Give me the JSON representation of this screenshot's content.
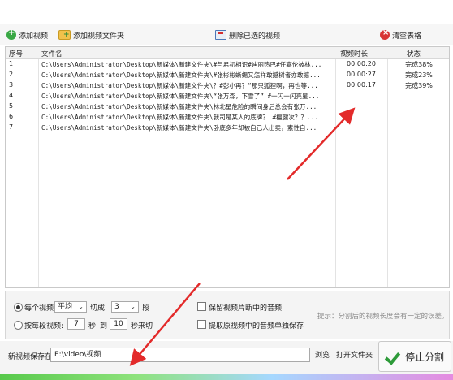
{
  "toolbar": {
    "add_video": "添加视频",
    "add_folder": "添加视频文件夹",
    "delete_selected": "删除已选的视频",
    "clear_table": "清空表格"
  },
  "table": {
    "headers": [
      "序号",
      "文件名",
      "视频时长",
      "状态"
    ],
    "rows": [
      {
        "no": "1",
        "file": "C:\\Users\\Administrator\\Desktop\\新媒体\\新建文件夹\\#与君初相识#迪丽热巴#任嘉伦被林...",
        "duration": "00:00:20",
        "status": "完成38%"
      },
      {
        "no": "2",
        "file": "C:\\Users\\Administrator\\Desktop\\新媒体\\新建文件夹\\#张彬彬蜥蜴又怎样敢撼树者亦敢撼...",
        "duration": "00:00:27",
        "status": "完成23%"
      },
      {
        "no": "3",
        "file": "C:\\Users\\Administrator\\Desktop\\新媒体\\新建文件夹\\？#彭小再？“那只狐狸啊，再也等...",
        "duration": "00:00:17",
        "status": "完成39%"
      },
      {
        "no": "4",
        "file": "C:\\Users\\Administrator\\Desktop\\新媒体\\新建文件夹\\“张万森，下雪了” #一闪一闪亮星...",
        "duration": "",
        "status": ""
      },
      {
        "no": "5",
        "file": "C:\\Users\\Administrator\\Desktop\\新媒体\\新建文件夹\\林北星危险的瞬间身后总会有张万...",
        "duration": "",
        "status": ""
      },
      {
        "no": "6",
        "file": "C:\\Users\\Administrator\\Desktop\\新媒体\\新建文件夹\\我司是某人的底牌？ #檀健次？？...",
        "duration": "",
        "status": ""
      },
      {
        "no": "7",
        "file": "C:\\Users\\Administrator\\Desktop\\新媒体\\新建文件夹\\卧底多年却被自己人出卖，索性自...",
        "duration": "",
        "status": ""
      }
    ]
  },
  "options": {
    "per_video_label": "每个视频",
    "mode_value": "平均",
    "cut_label": "切成:",
    "cut_count": "3",
    "segment_unit": "段",
    "by_each_label": "按每段视频:",
    "from_seconds": "7",
    "sec_label": "秒",
    "to_label": "到",
    "to_seconds": "10",
    "sec_cut_label": "秒来切",
    "keep_audio_label": "保留视频片断中的音频",
    "extract_audio_label": "提取原视频中的音频单独保存",
    "hint_text": "提示：分割后的视频长度会有一定的误差。"
  },
  "save": {
    "label": "新视频保存在:",
    "path": "E:\\video\\视频",
    "browse": "浏览",
    "open_folder": "打开文件夹",
    "stop_button": "停止分割"
  },
  "colors": {
    "accent_green": "#2e9b3a",
    "arrow_red": "#e32a2a",
    "status_text": "#222222"
  }
}
